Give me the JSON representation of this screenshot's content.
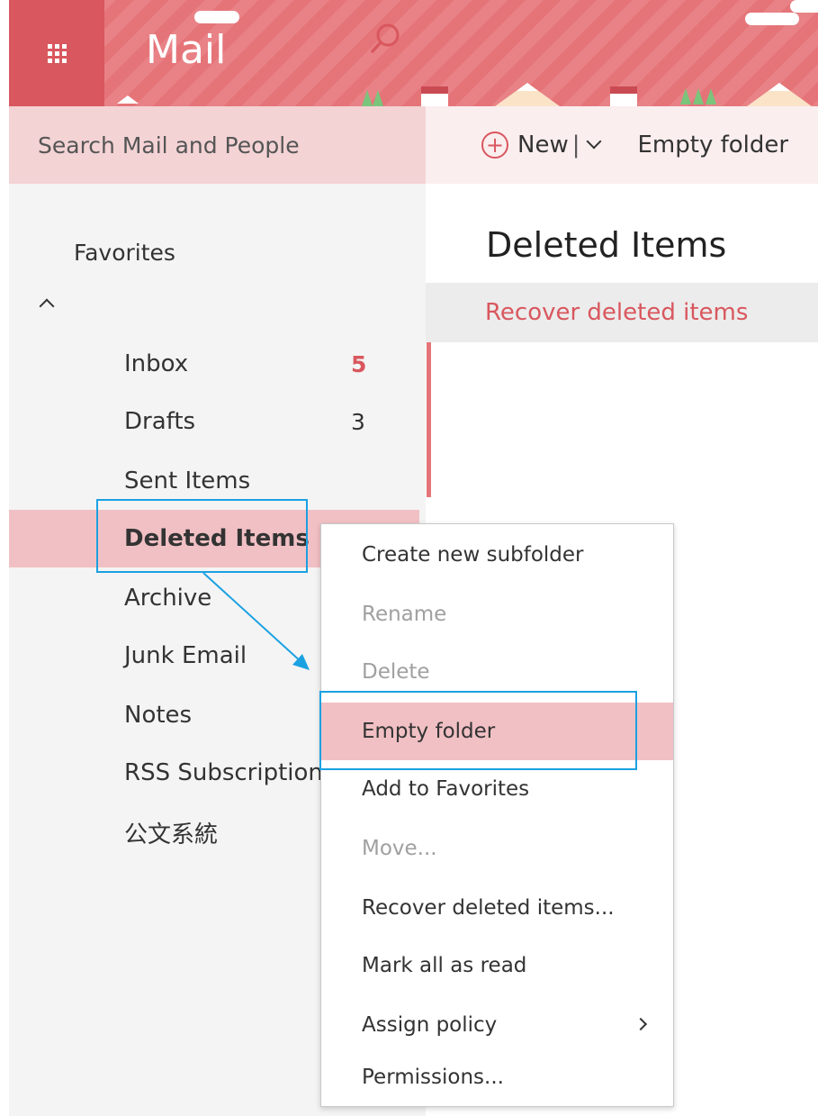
{
  "app": {
    "title": "Mail"
  },
  "search": {
    "placeholder": "Search Mail and People"
  },
  "toolbar": {
    "new_label": "New",
    "separator": "|",
    "empty_folder_label": "Empty folder"
  },
  "nav": {
    "favorites_label": "Favorites",
    "folders": [
      {
        "name": "Inbox",
        "count": "5",
        "unread": true
      },
      {
        "name": "Drafts",
        "count": "3",
        "unread": false
      },
      {
        "name": "Sent Items",
        "count": ""
      },
      {
        "name": "Deleted Items",
        "count": "",
        "selected": true
      },
      {
        "name": "Archive",
        "count": ""
      },
      {
        "name": "Junk Email",
        "count": ""
      },
      {
        "name": "Notes",
        "count": ""
      },
      {
        "name": "RSS Subscription",
        "count": ""
      },
      {
        "name": "公文系統",
        "count": ""
      }
    ]
  },
  "main": {
    "title": "Deleted Items",
    "recover_link": "Recover deleted items"
  },
  "context_menu": {
    "items": [
      {
        "label": "Create new subfolder",
        "state": "enabled"
      },
      {
        "label": "Rename",
        "state": "disabled"
      },
      {
        "label": "Delete",
        "state": "disabled"
      },
      {
        "label": "Empty folder",
        "state": "hover"
      },
      {
        "label": "Add to Favorites",
        "state": "enabled"
      },
      {
        "label": "Move...",
        "state": "disabled"
      },
      {
        "label": "Recover deleted items...",
        "state": "enabled"
      },
      {
        "label": "Mark all as read",
        "state": "enabled"
      },
      {
        "label": "Assign policy",
        "state": "enabled",
        "submenu": true
      },
      {
        "label": "Permissions...",
        "state": "enabled"
      }
    ]
  },
  "colors": {
    "brand": "#e57479",
    "brand_dark": "#d9575e",
    "selected_bg": "#f1c0c4",
    "annotation": "#1ba1e2"
  }
}
